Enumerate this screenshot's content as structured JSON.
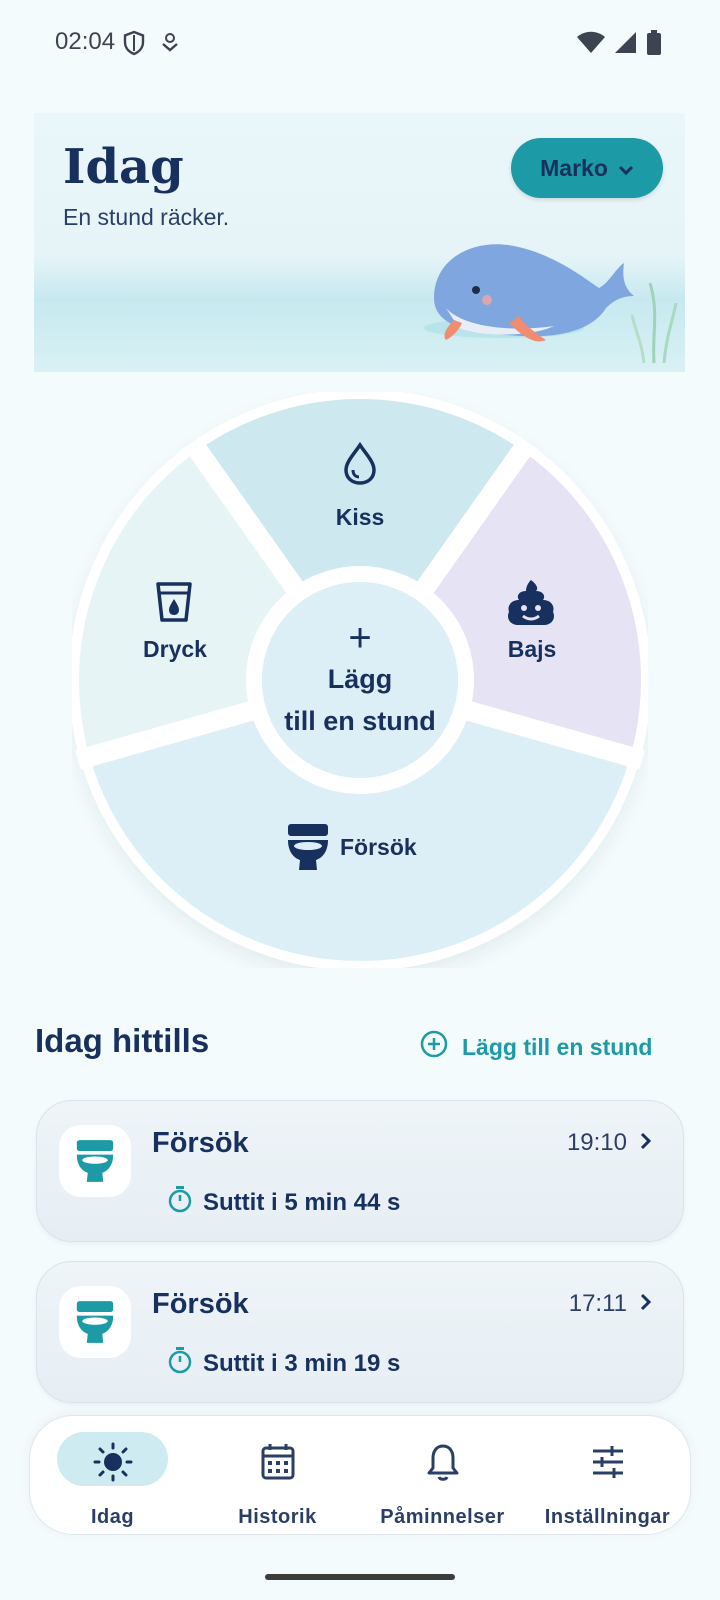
{
  "status": {
    "time": "02:04",
    "left_icons": [
      "shield-icon",
      "download-icon"
    ],
    "right_icons": [
      "wifi-icon",
      "signal-icon",
      "battery-icon"
    ]
  },
  "hero": {
    "title": "Idag",
    "subtitle": "En stund räcker.",
    "profile_name": "Marko"
  },
  "wheel": {
    "top_label": "Kiss",
    "left_label": "Dryck",
    "right_label": "Bajs",
    "bottom_label": "Försök",
    "center_plus": "+",
    "center_line1": "Lägg",
    "center_line2": "till en stund"
  },
  "today": {
    "title": "Idag hittills",
    "add_label": "Lägg till en stund",
    "entries": [
      {
        "title": "Försök",
        "time": "19:10",
        "detail": "Suttit i 5 min 44 s"
      },
      {
        "title": "Försök",
        "time": "17:11",
        "detail": "Suttit i 3 min 19 s"
      }
    ]
  },
  "nav": {
    "items": [
      {
        "label": "Idag",
        "icon": "sun-icon",
        "active": true
      },
      {
        "label": "Historik",
        "icon": "calendar-icon",
        "active": false
      },
      {
        "label": "Påminnelser",
        "icon": "bell-icon",
        "active": false
      },
      {
        "label": "Inställningar",
        "icon": "sliders-icon",
        "active": false
      }
    ]
  },
  "colors": {
    "accent": "#1c9aa6",
    "navy": "#17305e",
    "kiss": "#cde9ef",
    "bajs": "#e6e3f5",
    "dryck": "#e7f4f6",
    "forsok": "#dceef6"
  }
}
